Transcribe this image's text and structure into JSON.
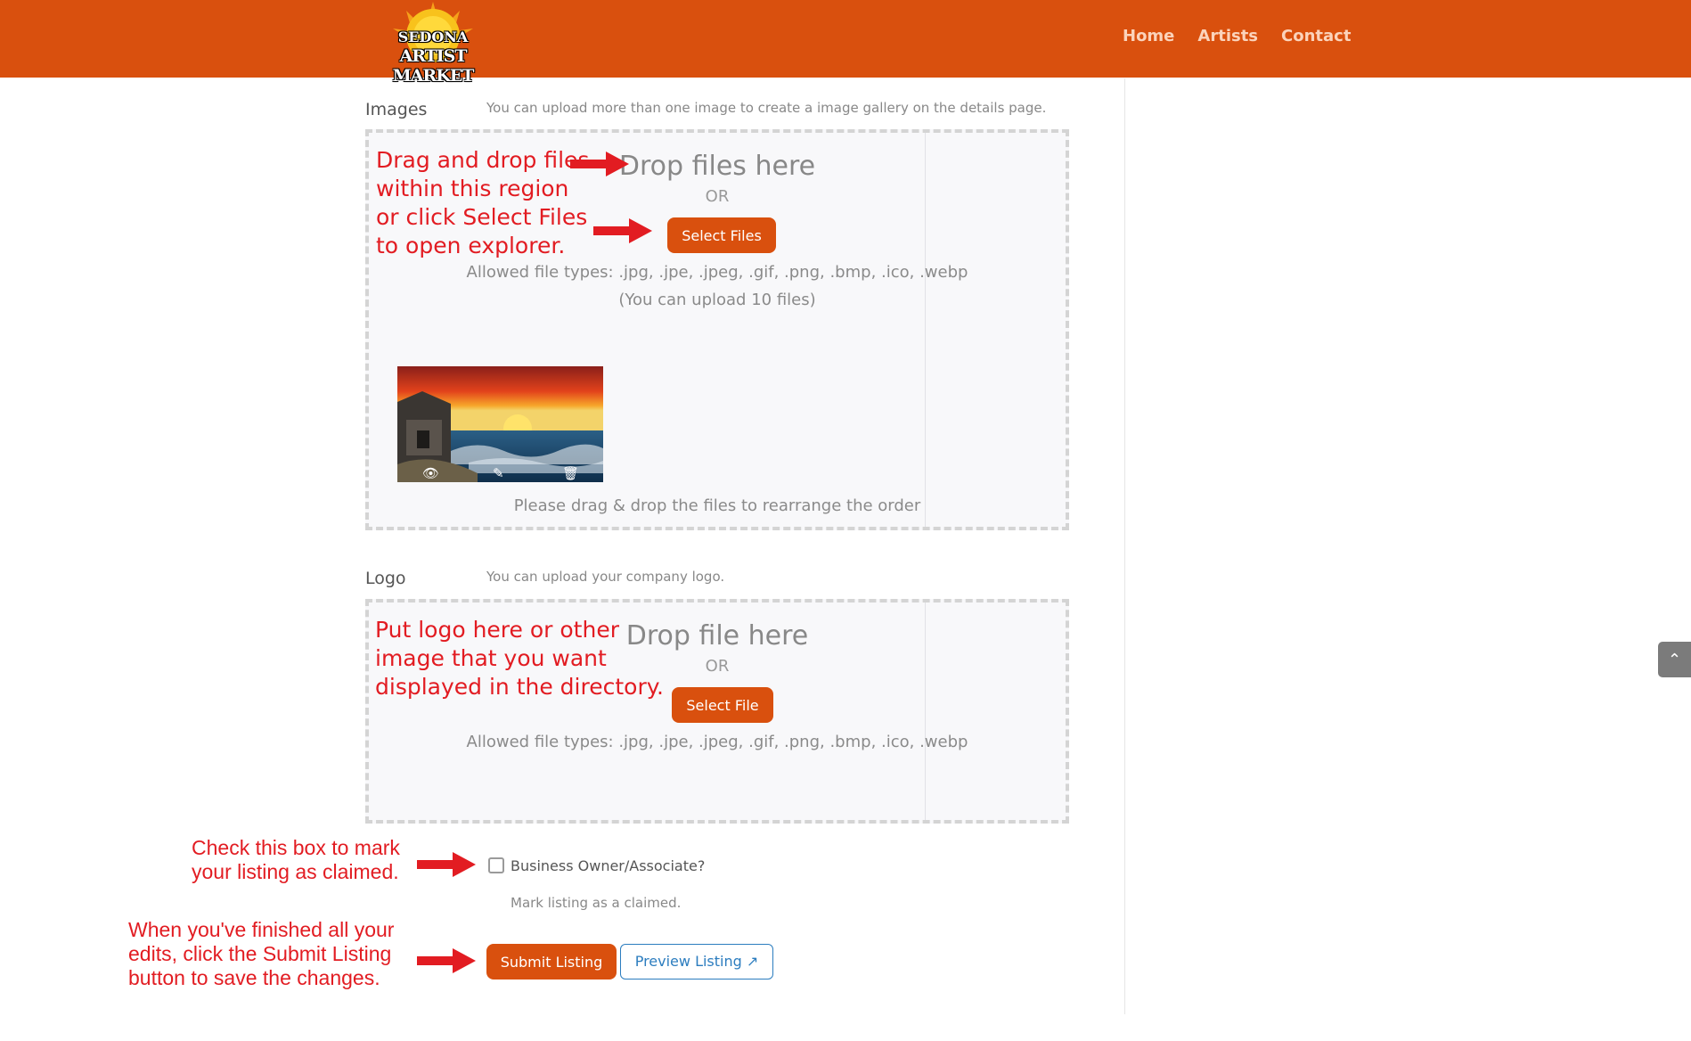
{
  "header": {
    "logo_top": "SEDONA",
    "logo_bottom": "ARTIST MARKET",
    "nav": [
      "Home",
      "Artists",
      "Contact"
    ]
  },
  "images_section": {
    "label": "Images",
    "description": "You can upload more than one image to create a image gallery on the details page.",
    "drop_title": "Drop files here",
    "or": "OR",
    "button": "Select Files",
    "allowed": "Allowed file types: .jpg, .jpe, .jpeg, .gif, .png, .bmp, .ico, .webp",
    "limit": "(You can upload 10 files)",
    "reorder_hint": "Please drag & drop the files to rearrange the order",
    "thumbnail_icons": [
      "eye-icon",
      "edit-icon",
      "trash-icon"
    ]
  },
  "logo_section": {
    "label": "Logo",
    "description": "You can upload your company logo.",
    "drop_title": "Drop file here",
    "or": "OR",
    "button": "Select File",
    "allowed": "Allowed file types: .jpg, .jpe, .jpeg, .gif, .png, .bmp, .ico, .webp"
  },
  "claim": {
    "label": "Business Owner/Associate?",
    "help": "Mark listing as a claimed.",
    "checked": false
  },
  "actions": {
    "submit": "Submit Listing",
    "preview": "Preview Listing"
  },
  "annotations": {
    "images_lines": [
      "Drag and drop files",
      "within this region",
      "or click Select Files",
      "to open explorer."
    ],
    "logo_lines": [
      "Put logo here or other",
      "image that you want",
      "displayed in the directory."
    ],
    "claim_lines": [
      "Check this box to mark",
      "your listing as claimed."
    ],
    "submit_lines": [
      "When you've finished all your",
      "edits, click the Submit Listing",
      "button to save the changes."
    ]
  },
  "colors": {
    "brand_orange": "#d9500e",
    "annotation_red": "#e21c22",
    "link_blue": "#2c7dbf"
  }
}
